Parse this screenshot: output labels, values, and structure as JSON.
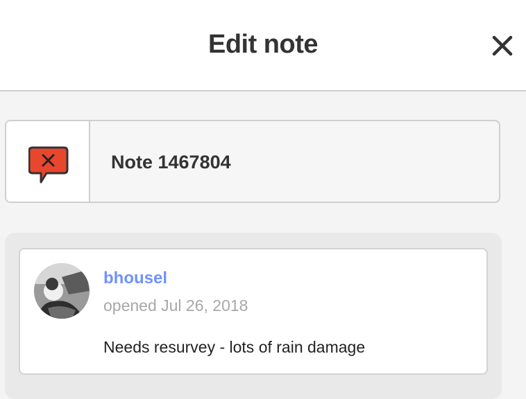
{
  "header": {
    "title": "Edit note",
    "close_icon": "close-icon"
  },
  "note": {
    "title": "Note 1467804",
    "icon": "note-closed-icon",
    "icon_color": "#e8472d"
  },
  "comment": {
    "author": "bhousel",
    "author_color": "#7092ff",
    "opened": "opened Jul 26, 2018",
    "text": "Needs resurvey - lots of rain damage",
    "avatar": "user-avatar"
  }
}
